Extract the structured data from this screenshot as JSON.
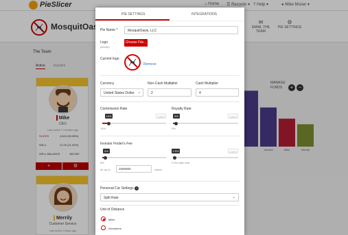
{
  "app": {
    "name": "PieSlicer"
  },
  "topnav": {
    "home": "Home",
    "records": "Records",
    "help": "Help",
    "user": "Mike Moser"
  },
  "org": {
    "name": "MosquitOasis,"
  },
  "header_buttons": {
    "email_team": "EMAIL THE TEAM",
    "pie_settings": "PIE SETTINGS"
  },
  "team": {
    "title": "The Team",
    "tabs": {
      "active": "Active",
      "inactive": "Inactive"
    },
    "members": [
      {
        "name": "Mike",
        "role": "CEO",
        "last_active": "Last active 7 minutes ago",
        "slices_label": "SLICES",
        "slices_value": "4,624 (30.98%)",
        "well_label": "WELL",
        "well_value": "21.00 (21.00%)",
        "well_balance_label": "WELL BALANCE",
        "well_balance_value": "480.050"
      },
      {
        "name": "Merrily",
        "role": "Customer Service",
        "last_active": "Last active 3 days ago"
      }
    ]
  },
  "card_buttons": {
    "add": "+",
    "settings": "⚙"
  },
  "chart_labels": {
    "manage_funds": "MANAGE FUNDS",
    "labels": [
      "Vincent",
      "Mike",
      "Merrily"
    ]
  },
  "chart_data": {
    "type": "bar",
    "categories": [
      "",
      "Vincent",
      "Mike",
      "Merrily"
    ],
    "values": [
      80,
      56,
      40,
      32
    ],
    "colors": [
      "#4b3b8a",
      "#4b3b8a",
      "#b51e34",
      "#7c8f30"
    ]
  },
  "modal": {
    "tabs": {
      "pie_settings": "PIE SETTINGS",
      "integrations": "INTEGRATIONS"
    },
    "pie_name_label": "Pie Name *",
    "pie_name_value": "MosquitOasis, LLC",
    "logo_label": "Logo",
    "logo_sub": "(64x64)",
    "choose_file": "Choose File...",
    "current_logo_label": "Current logo",
    "remove_link": "Remove",
    "currency_label": "Currency",
    "currency_value": "United States Dollar",
    "noncash_label": "Non-Cash Multiplier",
    "noncash_value": "2",
    "cash_label": "Cash Multiplier",
    "cash_value": "4",
    "commission_label": "Commission Rate",
    "commission_value": "10%",
    "commission_tip": "10%",
    "commission_max": "100%",
    "commission_fraction": 0.1,
    "royalty_label": "Royalty Rate",
    "royalty_value": "5%",
    "royalty_tip": "5%",
    "royalty_max": "100%",
    "royalty_fraction": 0.05,
    "finder_label": "Investor Finder's Fee",
    "finder_value": "5%",
    "finder_tip": "5%",
    "finder_fraction": 0.05,
    "finder2_value": "2.5% after that",
    "finder2_tip": "2.5%",
    "finder2_max": "100%",
    "finder2_fraction": 0.025,
    "upto_label": "for up to",
    "upto_value": "1000000",
    "raised_label": "raised",
    "personal_car_label": "Personal Car Settings",
    "personal_car_value": "Split Rate",
    "distance_label": "Unit of Distance",
    "distance_options": [
      "Miles",
      "Kilometers"
    ],
    "distance_selected": "Miles"
  },
  "colors": {
    "accent": "#cc0000",
    "brand_yellow": "#f5c32b"
  },
  "icons": {
    "logo": "pie-logo-icon",
    "home": "home-icon",
    "records": "records-icon",
    "help": "help-icon",
    "avatar": "avatar-icon",
    "email": "envelope-icon",
    "pie_settings": "gear-icon",
    "mosquito": "no-mosquito-icon",
    "add": "plus-icon",
    "remove": "minus-icon",
    "info": "info-icon",
    "dropdown": "chevron-down-icon"
  }
}
